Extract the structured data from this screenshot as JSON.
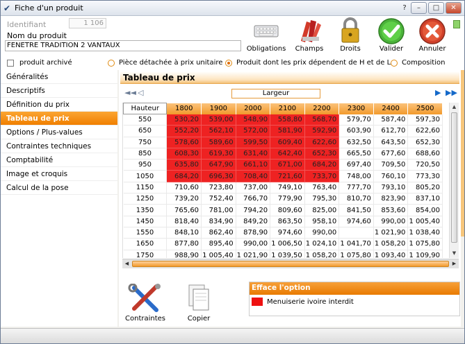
{
  "window": {
    "title": "Fiche d'un produit"
  },
  "header": {
    "id_label": "Identifiant",
    "id_value": "1 106",
    "name_label": "Nom du produit",
    "name_value": "FENETRE TRADITION 2 VANTAUX"
  },
  "toolbar": {
    "obligations": "Obligations",
    "champs": "Champs",
    "droits": "Droits",
    "valider": "Valider",
    "annuler": "Annuler"
  },
  "options": {
    "archive": "produit archivé",
    "piece": "Pièce détachée à prix unitaire",
    "produit_hl": "Produit dont les prix dépendent de H et de L",
    "composition": "Composition",
    "selected": "produit_hl"
  },
  "sidebar": {
    "items": [
      {
        "label": "Généralités",
        "active": false
      },
      {
        "label": "Descriptifs",
        "active": false
      },
      {
        "label": "Définition du prix",
        "active": false
      },
      {
        "label": "Tableau de prix",
        "active": true
      },
      {
        "label": "Options / Plus-values",
        "active": false
      },
      {
        "label": "Contraintes techniques",
        "active": false
      },
      {
        "label": "Comptabilité",
        "active": false
      },
      {
        "label": "Image et croquis",
        "active": false
      },
      {
        "label": "Calcul de la pose",
        "active": false
      }
    ]
  },
  "price_table": {
    "section_title": "Tableau de prix",
    "width_label": "Largeur",
    "height_label": "Hauteur",
    "widths": [
      "1800",
      "1900",
      "2000",
      "2100",
      "2200",
      "2300",
      "2400",
      "2500"
    ],
    "rows": [
      {
        "h": "550",
        "cells": [
          "530,20",
          "539,00",
          "548,90",
          "558,80",
          "568,70",
          "579,70",
          "587,40",
          "597,30"
        ]
      },
      {
        "h": "650",
        "cells": [
          "552,20",
          "562,10",
          "572,00",
          "581,90",
          "592,90",
          "603,90",
          "612,70",
          "622,60"
        ]
      },
      {
        "h": "750",
        "cells": [
          "578,60",
          "589,60",
          "599,50",
          "609,40",
          "622,60",
          "632,50",
          "643,50",
          "652,30"
        ]
      },
      {
        "h": "850",
        "cells": [
          "608,30",
          "619,30",
          "631,40",
          "642,40",
          "652,30",
          "665,50",
          "677,60",
          "688,60"
        ]
      },
      {
        "h": "950",
        "cells": [
          "635,80",
          "647,90",
          "661,10",
          "671,00",
          "684,20",
          "697,40",
          "709,50",
          "720,50"
        ]
      },
      {
        "h": "1050",
        "cells": [
          "684,20",
          "696,30",
          "708,40",
          "721,60",
          "733,70",
          "748,00",
          "760,10",
          "773,30"
        ]
      },
      {
        "h": "1150",
        "cells": [
          "710,60",
          "723,80",
          "737,00",
          "749,10",
          "763,40",
          "777,70",
          "793,10",
          "805,20"
        ]
      },
      {
        "h": "1250",
        "cells": [
          "739,20",
          "752,40",
          "766,70",
          "779,90",
          "795,30",
          "810,70",
          "823,90",
          "837,10"
        ]
      },
      {
        "h": "1350",
        "cells": [
          "765,60",
          "781,00",
          "794,20",
          "809,60",
          "825,00",
          "841,50",
          "853,60",
          "854,00"
        ]
      },
      {
        "h": "1450",
        "cells": [
          "818,40",
          "834,90",
          "849,20",
          "863,50",
          "958,10",
          "974,60",
          "990,00",
          "1 005,40"
        ]
      },
      {
        "h": "1550",
        "cells": [
          "848,10",
          "862,40",
          "878,90",
          "974,60",
          "990,00",
          "",
          "1 021,90",
          "1 038,40"
        ]
      },
      {
        "h": "1650",
        "cells": [
          "877,80",
          "895,40",
          "990,00",
          "1 006,50",
          "1 024,10",
          "1 041,70",
          "1 058,20",
          "1 075,80"
        ]
      },
      {
        "h": "1750",
        "cells": [
          "988,90",
          "1 005,40",
          "1 021,90",
          "1 039,50",
          "1 058,20",
          "1 075,80",
          "1 093,40",
          "1 109,90"
        ]
      }
    ],
    "red_rows": 6,
    "red_cols": 5
  },
  "bottom": {
    "contraintes": "Contraintes",
    "copier": "Copier",
    "legend_title": "Efface l'option",
    "legend_item": "Menuiserie ivoire interdit",
    "legend_color": "#ee1111"
  }
}
